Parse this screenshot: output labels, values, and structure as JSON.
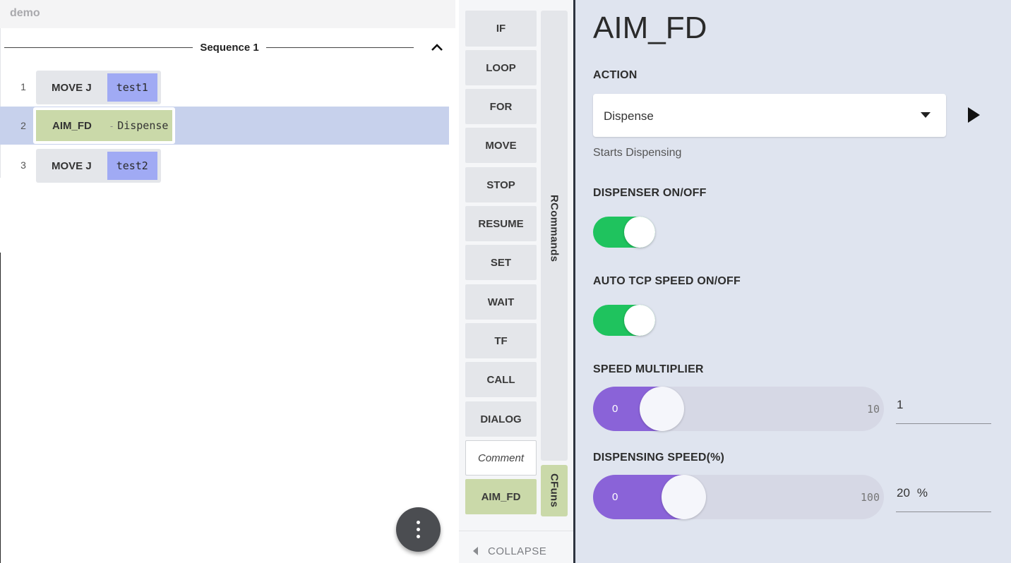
{
  "app": {
    "title": "demo"
  },
  "sequence": {
    "title": "Sequence 1",
    "rows": [
      {
        "number": "1",
        "command": "MOVE J",
        "param": "test1"
      },
      {
        "number": "2",
        "command": "AIM_FD",
        "param": "Dispense",
        "dash": "-"
      },
      {
        "number": "3",
        "command": "MOVE J",
        "param": "test2"
      }
    ]
  },
  "palette": {
    "commands": [
      "IF",
      "LOOP",
      "FOR",
      "MOVE",
      "STOP",
      "RESUME",
      "SET",
      "WAIT",
      "TF",
      "CALL",
      "DIALOG"
    ],
    "comment_label": "Comment",
    "custom_command": "AIM_FD",
    "tabs": {
      "rcommands": "RCommands",
      "cfuns": "CFuns"
    },
    "collapse_label": "COLLAPSE"
  },
  "detail": {
    "title": "AIM_FD",
    "action": {
      "label": "ACTION",
      "value": "Dispense",
      "hint": "Starts Dispensing"
    },
    "dispenser": {
      "label": "DISPENSER ON/OFF",
      "on": true
    },
    "auto_tcp": {
      "label": "AUTO TCP SPEED ON/OFF",
      "on": true
    },
    "speed_multiplier": {
      "label": "SPEED MULTIPLIER",
      "min": "0",
      "max": "10",
      "value": "1",
      "level": 0.1
    },
    "dispensing_speed": {
      "label": "DISPENSING SPEED(%)",
      "min": "0",
      "max": "100",
      "value": "20",
      "unit": "%",
      "level": 0.2
    }
  },
  "colors": {
    "selected_row": "#c7d1ec",
    "move_param": "#a0aaf4",
    "custom_command": "#cad9a9",
    "toggle_on": "#1fc35e",
    "slider_fill": "#8a63d8",
    "panel_bg": "#dfe4ef"
  }
}
